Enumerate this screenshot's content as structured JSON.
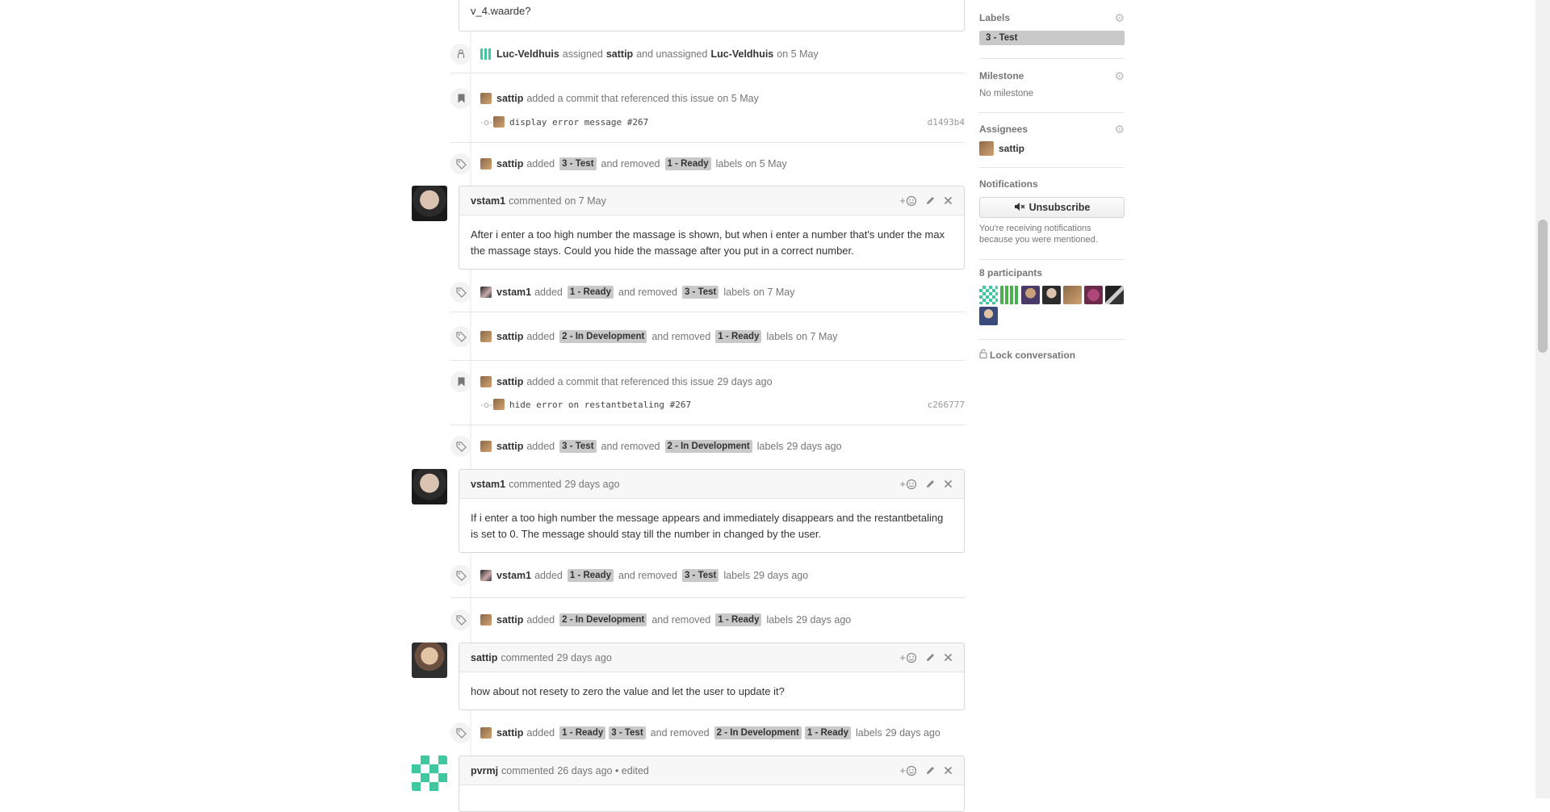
{
  "top_snippet": {
    "text": "v_4.waarde?"
  },
  "events": {
    "assign": {
      "actor": "Luc-Veldhuis",
      "verb1": "assigned",
      "target1": "sattip",
      "verb2": "and unassigned",
      "target2": "Luc-Veldhuis",
      "time": "on 5 May"
    },
    "commit1": {
      "actor": "sattip",
      "text": "added a commit that referenced this issue",
      "time": "on 5 May"
    },
    "commit1_row": {
      "message": "display error message #267",
      "sha": "d1493b4"
    },
    "label1": {
      "actor": "sattip",
      "added": "added",
      "label_a": "3 - Test",
      "removed": "and removed",
      "label_b": "1 - Ready",
      "suffix": "labels",
      "time": "on 5 May"
    },
    "label2": {
      "actor": "vstam1",
      "added": "added",
      "label_a": "1 - Ready",
      "removed": "and removed",
      "label_b": "3 - Test",
      "suffix": "labels",
      "time": "on 7 May"
    },
    "label3": {
      "actor": "sattip",
      "added": "added",
      "label_a": "2 - In Development",
      "removed": "and removed",
      "label_b": "1 - Ready",
      "suffix": "labels",
      "time": "on 7 May"
    },
    "commit2": {
      "actor": "sattip",
      "text": "added a commit that referenced this issue",
      "time": "29 days ago"
    },
    "commit2_row": {
      "message": "hide error on restantbetaling #267",
      "sha": "c266777"
    },
    "label4": {
      "actor": "sattip",
      "added": "added",
      "label_a": "3 - Test",
      "removed": "and removed",
      "label_b": "2 - In Development",
      "suffix": "labels",
      "time": "29 days ago"
    },
    "label5": {
      "actor": "vstam1",
      "added": "added",
      "label_a": "1 - Ready",
      "removed": "and removed",
      "label_b": "3 - Test",
      "suffix": "labels",
      "time": "29 days ago"
    },
    "label6": {
      "actor": "sattip",
      "added": "added",
      "label_a": "2 - In Development",
      "removed": "and removed",
      "label_b": "1 - Ready",
      "suffix": "labels",
      "time": "29 days ago"
    },
    "label7": {
      "actor": "sattip",
      "added": "added",
      "label_a": "1 - Ready",
      "label_c": "3 - Test",
      "removed": "and removed",
      "label_b": "2 - In Development",
      "label_d": "1 - Ready",
      "suffix": "labels",
      "time": "29 days ago"
    }
  },
  "comments": {
    "c1": {
      "author": "vstam1",
      "verb": "commented",
      "time": "on 7 May",
      "body": "After i enter a too high number the massage is shown, but when i enter a number that's under the max the massage stays. Could you hide the massage after you put in a correct number."
    },
    "c2": {
      "author": "vstam1",
      "verb": "commented",
      "time": "29 days ago",
      "body": "If i enter a too high number the message appears and immediately disappears and the restantbetaling is set to 0. The message should stay till the number in changed by the user."
    },
    "c3": {
      "author": "sattip",
      "verb": "commented",
      "time": "29 days ago",
      "body": "how about not resety to zero the value and let the user to update it?"
    },
    "c4": {
      "author": "pvrmj",
      "verb": "commented",
      "time": "26 days ago • edited",
      "body": ""
    }
  },
  "actions": {
    "reaction": "+",
    "edit": "edit",
    "delete": "delete"
  },
  "sidebar": {
    "labels": {
      "title": "Labels",
      "value": "3 - Test"
    },
    "milestone": {
      "title": "Milestone",
      "value": "No milestone"
    },
    "assignees": {
      "title": "Assignees",
      "value": "sattip"
    },
    "notifications": {
      "title": "Notifications",
      "button": "Unsubscribe",
      "note": "You're receiving notifications because you were mentioned."
    },
    "participants": {
      "title": "8 participants"
    },
    "lock": {
      "label": "Lock conversation"
    }
  },
  "colors": {
    "label_bg": "#c9c9c9",
    "accent": "#4078c0",
    "identicon_green": "#3fc7a0"
  }
}
